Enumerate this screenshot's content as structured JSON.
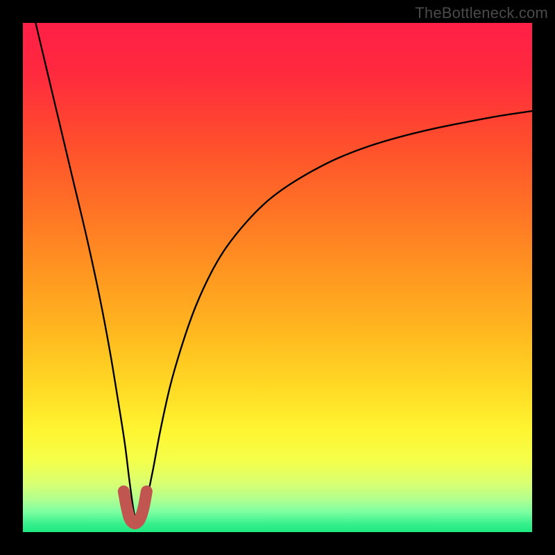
{
  "watermark": "TheBottleneck.com",
  "colors": {
    "frame": "#000000",
    "curve_stroke": "#000000",
    "marker_stroke": "#c1554f",
    "gradient_stops": [
      {
        "offset": 0.0,
        "color": "#ff1f47"
      },
      {
        "offset": 0.1,
        "color": "#ff2a3e"
      },
      {
        "offset": 0.22,
        "color": "#ff4a2e"
      },
      {
        "offset": 0.35,
        "color": "#ff6e26"
      },
      {
        "offset": 0.48,
        "color": "#ff9321"
      },
      {
        "offset": 0.6,
        "color": "#ffb61f"
      },
      {
        "offset": 0.72,
        "color": "#ffdb25"
      },
      {
        "offset": 0.8,
        "color": "#fff531"
      },
      {
        "offset": 0.86,
        "color": "#f4ff4a"
      },
      {
        "offset": 0.905,
        "color": "#d8ff72"
      },
      {
        "offset": 0.935,
        "color": "#b2ff8e"
      },
      {
        "offset": 0.96,
        "color": "#7dffa2"
      },
      {
        "offset": 0.985,
        "color": "#34ef8b"
      },
      {
        "offset": 1.0,
        "color": "#20e982"
      }
    ]
  },
  "chart_data": {
    "type": "line",
    "title": "",
    "xlabel": "",
    "ylabel": "",
    "xlim": [
      0,
      100
    ],
    "ylim": [
      0,
      100
    ],
    "grid": false,
    "note": "Axis labels and ticks are not visible in the image; values are estimated on a 0–100 normalized scale read from pixel positions. Curve dips to ~0 at x≈22 and rises asymptotically toward ~83 at x=100.",
    "series": [
      {
        "name": "bottleneck-curve",
        "x": [
          2.5,
          5.0,
          7.5,
          10.0,
          12.5,
          15.0,
          17.0,
          18.5,
          20.0,
          21.0,
          22.0,
          23.0,
          24.0,
          25.5,
          27.0,
          29.0,
          31.5,
          34.0,
          37.0,
          40.0,
          44.0,
          48.0,
          52.0,
          57.0,
          62.0,
          68.0,
          74.0,
          81.0,
          88.0,
          94.0,
          100.0
        ],
        "values": [
          100,
          89.5,
          79.0,
          68.5,
          58.0,
          46.5,
          36.0,
          27.0,
          17.5,
          9.5,
          3.0,
          2.0,
          5.0,
          12.0,
          20.0,
          29.0,
          37.5,
          44.5,
          51.0,
          56.0,
          61.0,
          65.0,
          68.0,
          71.0,
          73.5,
          75.8,
          77.6,
          79.3,
          80.7,
          81.8,
          82.7
        ]
      }
    ],
    "highlight_region": {
      "description": "Thick reddish U-shaped marker at curve minimum",
      "x": [
        19.8,
        20.4,
        21.0,
        21.7,
        22.3,
        23.0,
        23.7,
        24.3
      ],
      "values": [
        8.0,
        4.8,
        2.6,
        1.8,
        1.8,
        2.6,
        4.8,
        8.0
      ]
    }
  }
}
